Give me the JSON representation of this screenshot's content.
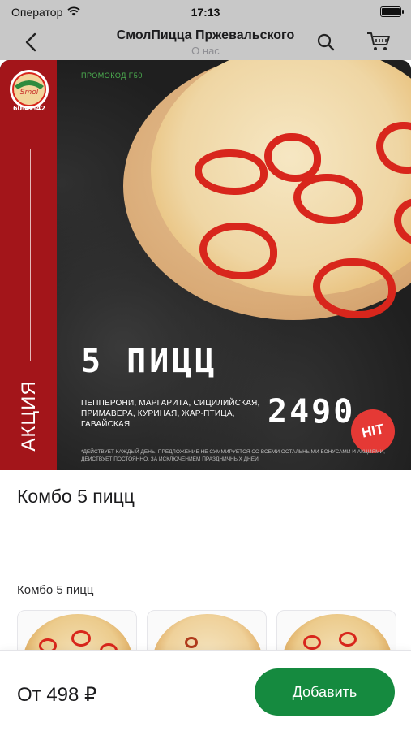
{
  "status_bar": {
    "carrier": "Оператор",
    "time": "17:13",
    "battery_level": 1.0
  },
  "nav": {
    "title": "СмолПицца Пржевальского",
    "subtitle": "О нас"
  },
  "banner": {
    "side_text": "АКЦИЯ",
    "promo_code": "ПРОМОКОД F50",
    "headline": "5 ПИЦЦ",
    "pizza_list": "ПЕППЕРОНИ, МАРГАРИТА, СИЦИЛИЙСКАЯ, ПРИМАВЕРА, КУРИНАЯ, ЖАР-ПТИЦА, ГАВАЙСКАЯ",
    "price": "2490",
    "badge": "HIT",
    "footnote": "*ДЕЙСТВУЕТ КАЖДЫЙ ДЕНЬ. ПРЕДЛОЖЕНИЕ НЕ СУММИРУЕТСЯ СО ВСЕМИ ОСТАЛЬНЫМИ БОНУСАМИ И АКЦИЯМИ, ДЕЙСТВУЕТ ПОСТОЯННО, ЗА ИСКЛЮЧЕНИЕМ ПРАЗДНИЧНЫХ ДНЕЙ",
    "logo_text": "60-42-42"
  },
  "product": {
    "title": "Комбо 5 пицц",
    "section_label": "Комбо 5 пицц"
  },
  "footer": {
    "price": "От 498 ₽",
    "add_label": "Добавить"
  },
  "colors": {
    "accent_green": "#158a3f",
    "banner_red": "#a3151a",
    "badge_red": "#e53935"
  }
}
